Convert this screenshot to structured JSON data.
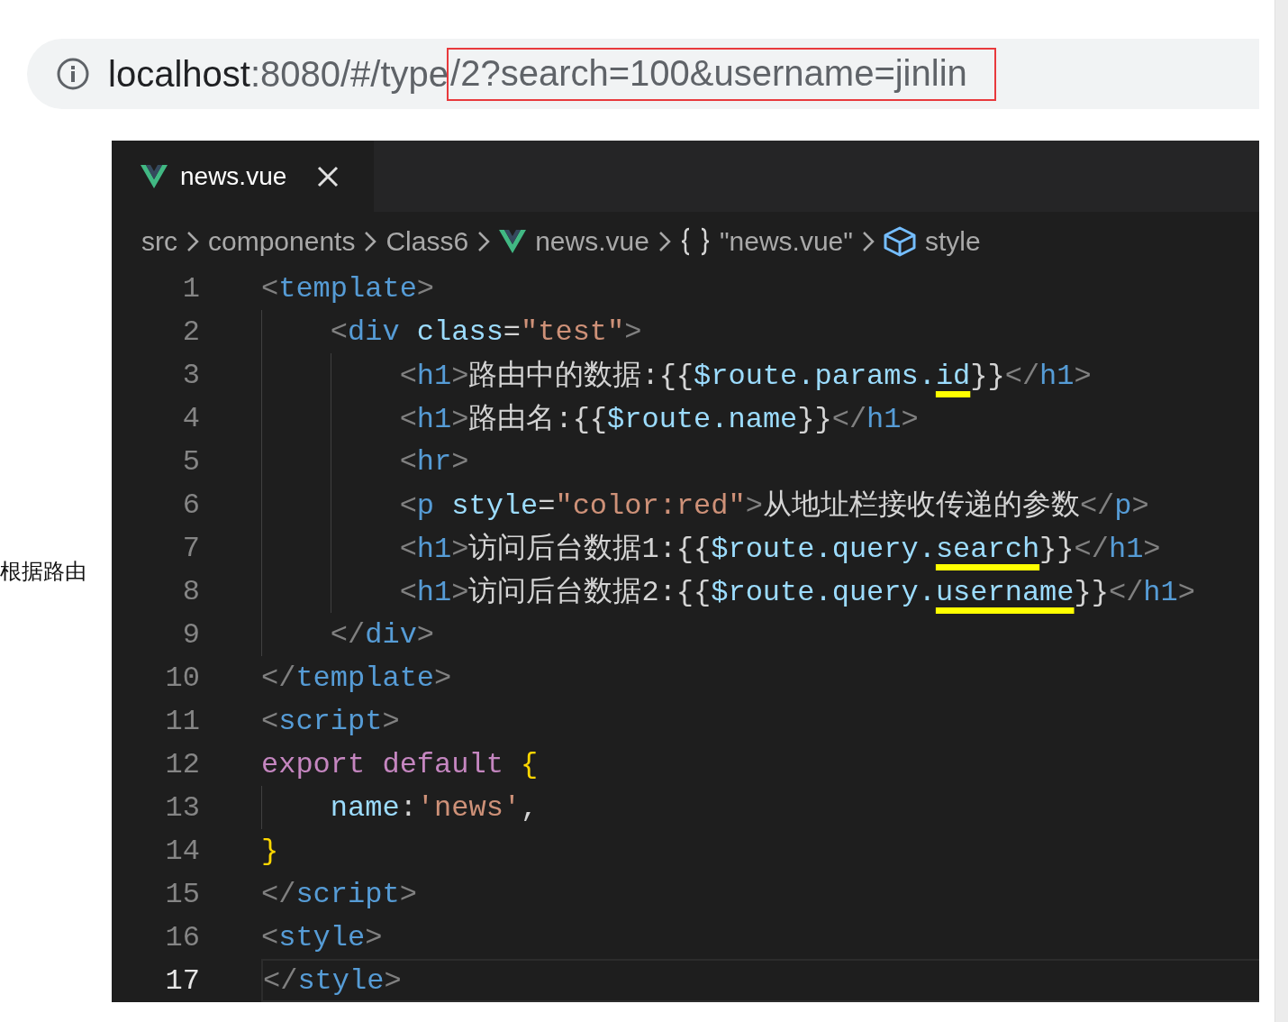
{
  "address_bar": {
    "segments": [
      {
        "text": "localhost",
        "kind": "host",
        "boxed": false
      },
      {
        "text": ":8080/#/type",
        "kind": "path",
        "boxed": false
      },
      {
        "text": "/2?search=100&username=jinlin",
        "kind": "path",
        "boxed": true
      }
    ]
  },
  "side_note": "根据路由",
  "editor": {
    "tabs": [
      {
        "label": "news.vue",
        "selected": true
      }
    ],
    "breadcrumbs": [
      {
        "label": "src",
        "kind": "folder"
      },
      {
        "label": "components",
        "kind": "folder"
      },
      {
        "label": "Class6",
        "kind": "folder"
      },
      {
        "label": "news.vue",
        "kind": "vue"
      },
      {
        "label": "\"news.vue\"",
        "kind": "object"
      },
      {
        "label": "style",
        "kind": "element"
      }
    ],
    "lines": [
      {
        "number": "1",
        "current": false,
        "tokens": [
          {
            "text": "<",
            "kind": "punct"
          },
          {
            "text": "template",
            "kind": "tag"
          },
          {
            "text": ">",
            "kind": "punct"
          }
        ]
      },
      {
        "number": "2",
        "current": false,
        "tokens": [
          {
            "text": "    <",
            "kind": "punct"
          },
          {
            "text": "div",
            "kind": "tag"
          },
          {
            "text": " class",
            "kind": "attr"
          },
          {
            "text": "=",
            "kind": "text"
          },
          {
            "text": "\"test\"",
            "kind": "string"
          },
          {
            "text": ">",
            "kind": "punct"
          }
        ]
      },
      {
        "number": "3",
        "current": false,
        "tokens": [
          {
            "text": "        <",
            "kind": "punct"
          },
          {
            "text": "h1",
            "kind": "tag"
          },
          {
            "text": ">",
            "kind": "punct"
          },
          {
            "text": "路由中的数据:{{",
            "kind": "text"
          },
          {
            "text": "$route.params.",
            "kind": "var"
          },
          {
            "text": "id",
            "kind": "var",
            "underlined": true
          },
          {
            "text": "}}",
            "kind": "text"
          },
          {
            "text": "</",
            "kind": "punct"
          },
          {
            "text": "h1",
            "kind": "tag"
          },
          {
            "text": ">",
            "kind": "punct"
          }
        ]
      },
      {
        "number": "4",
        "current": false,
        "tokens": [
          {
            "text": "        <",
            "kind": "punct"
          },
          {
            "text": "h1",
            "kind": "tag"
          },
          {
            "text": ">",
            "kind": "punct"
          },
          {
            "text": "路由名:{{",
            "kind": "text"
          },
          {
            "text": "$route.name",
            "kind": "var"
          },
          {
            "text": "}}",
            "kind": "text"
          },
          {
            "text": "</",
            "kind": "punct"
          },
          {
            "text": "h1",
            "kind": "tag"
          },
          {
            "text": ">",
            "kind": "punct"
          }
        ]
      },
      {
        "number": "5",
        "current": false,
        "tokens": [
          {
            "text": "        <",
            "kind": "punct"
          },
          {
            "text": "hr",
            "kind": "tag"
          },
          {
            "text": ">",
            "kind": "punct"
          }
        ]
      },
      {
        "number": "6",
        "current": false,
        "tokens": [
          {
            "text": "        <",
            "kind": "punct"
          },
          {
            "text": "p",
            "kind": "tag"
          },
          {
            "text": " style",
            "kind": "attr"
          },
          {
            "text": "=",
            "kind": "text"
          },
          {
            "text": "\"color:red\"",
            "kind": "string"
          },
          {
            "text": ">",
            "kind": "punct"
          },
          {
            "text": "从地址栏接收传递的参数",
            "kind": "text"
          },
          {
            "text": "</",
            "kind": "punct"
          },
          {
            "text": "p",
            "kind": "tag"
          },
          {
            "text": ">",
            "kind": "punct"
          }
        ]
      },
      {
        "number": "7",
        "current": false,
        "tokens": [
          {
            "text": "        <",
            "kind": "punct"
          },
          {
            "text": "h1",
            "kind": "tag"
          },
          {
            "text": ">",
            "kind": "punct"
          },
          {
            "text": "访问后台数据1:{{",
            "kind": "text"
          },
          {
            "text": "$route.query.",
            "kind": "var"
          },
          {
            "text": "search",
            "kind": "var",
            "underlined": true
          },
          {
            "text": "}}",
            "kind": "text"
          },
          {
            "text": "</",
            "kind": "punct"
          },
          {
            "text": "h1",
            "kind": "tag"
          },
          {
            "text": ">",
            "kind": "punct"
          }
        ]
      },
      {
        "number": "8",
        "current": false,
        "tokens": [
          {
            "text": "        <",
            "kind": "punct"
          },
          {
            "text": "h1",
            "kind": "tag"
          },
          {
            "text": ">",
            "kind": "punct"
          },
          {
            "text": "访问后台数据2:{{",
            "kind": "text"
          },
          {
            "text": "$route.query.",
            "kind": "var"
          },
          {
            "text": "username",
            "kind": "var",
            "underlined": true
          },
          {
            "text": "}}",
            "kind": "text"
          },
          {
            "text": "</",
            "kind": "punct"
          },
          {
            "text": "h1",
            "kind": "tag"
          },
          {
            "text": ">",
            "kind": "punct"
          }
        ]
      },
      {
        "number": "9",
        "current": false,
        "tokens": [
          {
            "text": "    </",
            "kind": "punct"
          },
          {
            "text": "div",
            "kind": "tag"
          },
          {
            "text": ">",
            "kind": "punct"
          }
        ]
      },
      {
        "number": "10",
        "current": false,
        "tokens": [
          {
            "text": "</",
            "kind": "punct"
          },
          {
            "text": "template",
            "kind": "tag"
          },
          {
            "text": ">",
            "kind": "punct"
          }
        ]
      },
      {
        "number": "11",
        "current": false,
        "tokens": [
          {
            "text": "<",
            "kind": "punct"
          },
          {
            "text": "script",
            "kind": "tag"
          },
          {
            "text": ">",
            "kind": "punct"
          }
        ]
      },
      {
        "number": "12",
        "current": false,
        "tokens": [
          {
            "text": "export default ",
            "kind": "keyword"
          },
          {
            "text": "{",
            "kind": "brace"
          }
        ]
      },
      {
        "number": "13",
        "current": false,
        "tokens": [
          {
            "text": "    name",
            "kind": "attr"
          },
          {
            "text": ":",
            "kind": "text"
          },
          {
            "text": "'news'",
            "kind": "string"
          },
          {
            "text": ",",
            "kind": "text"
          }
        ]
      },
      {
        "number": "14",
        "current": false,
        "tokens": [
          {
            "text": "}",
            "kind": "brace"
          }
        ]
      },
      {
        "number": "15",
        "current": false,
        "tokens": [
          {
            "text": "</",
            "kind": "punct"
          },
          {
            "text": "script",
            "kind": "tag"
          },
          {
            "text": ">",
            "kind": "punct"
          }
        ]
      },
      {
        "number": "16",
        "current": false,
        "tokens": [
          {
            "text": "<",
            "kind": "punct"
          },
          {
            "text": "style",
            "kind": "tag"
          },
          {
            "text": ">",
            "kind": "punct"
          }
        ]
      },
      {
        "number": "17",
        "current": true,
        "tokens": [
          {
            "text": "</",
            "kind": "punct"
          },
          {
            "text": "style",
            "kind": "tag"
          },
          {
            "text": ">",
            "kind": "punct"
          }
        ]
      }
    ]
  }
}
